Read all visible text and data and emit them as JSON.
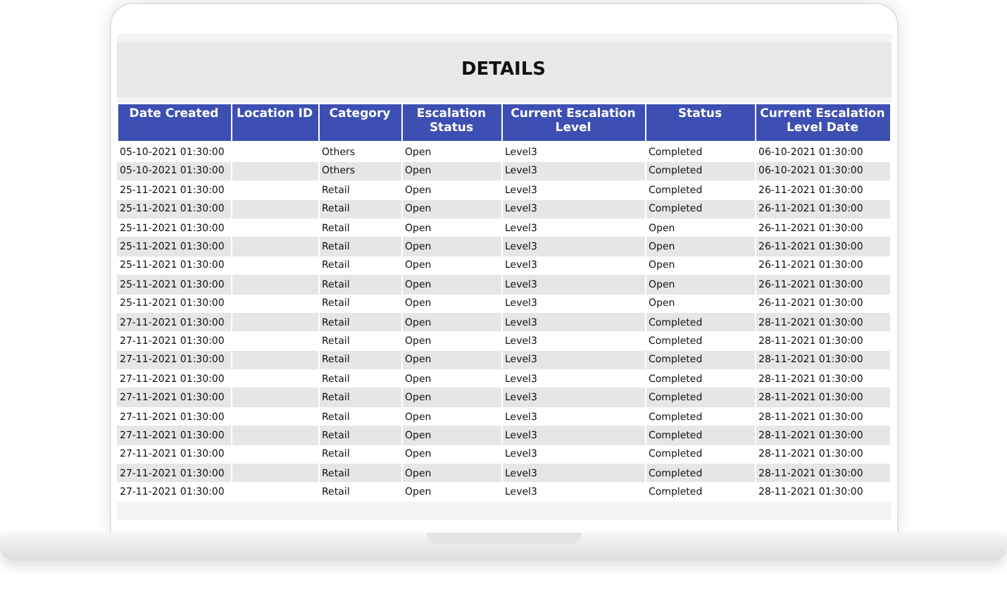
{
  "title": "DETAILS",
  "table": {
    "columns": [
      "Date Created",
      "Location ID",
      "Category",
      "Escalation Status",
      "Current Escalation Level",
      "Status",
      "Current Escalation Level Date"
    ],
    "rows": [
      {
        "date_created": "05-10-2021 01:30:00",
        "category": "Others",
        "escalation_status": "Open",
        "current_escalation_level": "Level3",
        "status": "Completed",
        "current_escalation_level_date": "06-10-2021 01:30:00"
      },
      {
        "date_created": "05-10-2021 01:30:00",
        "category": "Others",
        "escalation_status": "Open",
        "current_escalation_level": "Level3",
        "status": "Completed",
        "current_escalation_level_date": "06-10-2021 01:30:00"
      },
      {
        "date_created": "25-11-2021 01:30:00",
        "category": "Retail",
        "escalation_status": "Open",
        "current_escalation_level": "Level3",
        "status": "Completed",
        "current_escalation_level_date": "26-11-2021 01:30:00"
      },
      {
        "date_created": "25-11-2021 01:30:00",
        "category": "Retail",
        "escalation_status": "Open",
        "current_escalation_level": "Level3",
        "status": "Completed",
        "current_escalation_level_date": "26-11-2021 01:30:00"
      },
      {
        "date_created": "25-11-2021 01:30:00",
        "category": "Retail",
        "escalation_status": "Open",
        "current_escalation_level": "Level3",
        "status": "Open",
        "current_escalation_level_date": "26-11-2021 01:30:00"
      },
      {
        "date_created": "25-11-2021 01:30:00",
        "category": "Retail",
        "escalation_status": "Open",
        "current_escalation_level": "Level3",
        "status": "Open",
        "current_escalation_level_date": "26-11-2021 01:30:00"
      },
      {
        "date_created": "25-11-2021 01:30:00",
        "category": "Retail",
        "escalation_status": "Open",
        "current_escalation_level": "Level3",
        "status": "Open",
        "current_escalation_level_date": "26-11-2021 01:30:00"
      },
      {
        "date_created": "25-11-2021 01:30:00",
        "category": "Retail",
        "escalation_status": "Open",
        "current_escalation_level": "Level3",
        "status": "Open",
        "current_escalation_level_date": "26-11-2021 01:30:00"
      },
      {
        "date_created": "25-11-2021 01:30:00",
        "category": "Retail",
        "escalation_status": "Open",
        "current_escalation_level": "Level3",
        "status": "Open",
        "current_escalation_level_date": "26-11-2021 01:30:00"
      },
      {
        "date_created": "27-11-2021 01:30:00",
        "category": "Retail",
        "escalation_status": "Open",
        "current_escalation_level": "Level3",
        "status": "Completed",
        "current_escalation_level_date": "28-11-2021 01:30:00"
      },
      {
        "date_created": "27-11-2021 01:30:00",
        "category": "Retail",
        "escalation_status": "Open",
        "current_escalation_level": "Level3",
        "status": "Completed",
        "current_escalation_level_date": "28-11-2021 01:30:00"
      },
      {
        "date_created": "27-11-2021 01:30:00",
        "category": "Retail",
        "escalation_status": "Open",
        "current_escalation_level": "Level3",
        "status": "Completed",
        "current_escalation_level_date": "28-11-2021 01:30:00"
      },
      {
        "date_created": "27-11-2021 01:30:00",
        "category": "Retail",
        "escalation_status": "Open",
        "current_escalation_level": "Level3",
        "status": "Completed",
        "current_escalation_level_date": "28-11-2021 01:30:00"
      },
      {
        "date_created": "27-11-2021 01:30:00",
        "category": "Retail",
        "escalation_status": "Open",
        "current_escalation_level": "Level3",
        "status": "Completed",
        "current_escalation_level_date": "28-11-2021 01:30:00"
      },
      {
        "date_created": "27-11-2021 01:30:00",
        "category": "Retail",
        "escalation_status": "Open",
        "current_escalation_level": "Level3",
        "status": "Completed",
        "current_escalation_level_date": "28-11-2021 01:30:00"
      },
      {
        "date_created": "27-11-2021 01:30:00",
        "category": "Retail",
        "escalation_status": "Open",
        "current_escalation_level": "Level3",
        "status": "Completed",
        "current_escalation_level_date": "28-11-2021 01:30:00"
      },
      {
        "date_created": "27-11-2021 01:30:00",
        "category": "Retail",
        "escalation_status": "Open",
        "current_escalation_level": "Level3",
        "status": "Completed",
        "current_escalation_level_date": "28-11-2021 01:30:00"
      },
      {
        "date_created": "27-11-2021 01:30:00",
        "category": "Retail",
        "escalation_status": "Open",
        "current_escalation_level": "Level3",
        "status": "Completed",
        "current_escalation_level_date": "28-11-2021 01:30:00"
      },
      {
        "date_created": "27-11-2021 01:30:00",
        "category": "Retail",
        "escalation_status": "Open",
        "current_escalation_level": "Level3",
        "status": "Completed",
        "current_escalation_level_date": "28-11-2021 01:30:00"
      }
    ]
  }
}
